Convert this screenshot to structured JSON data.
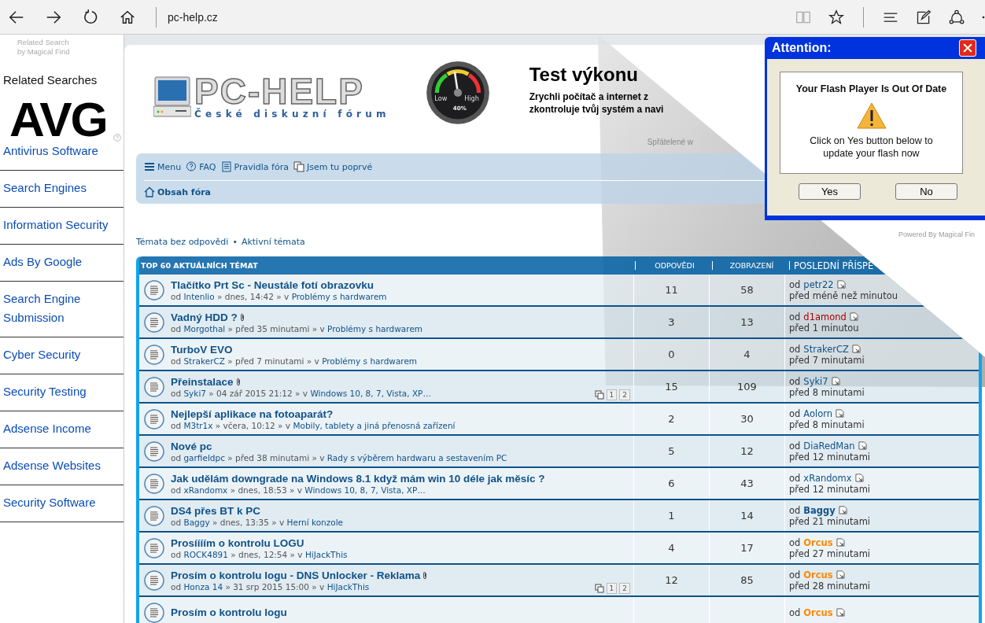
{
  "browser": {
    "url": "pc-help.cz"
  },
  "sidebar": {
    "credit_1": "Related Search",
    "credit_2": "by Magical Find",
    "heading": "Related Searches",
    "logo": "AVG",
    "links": [
      {
        "label": "Antivirus Software"
      },
      {
        "label": "Search Engines"
      },
      {
        "label": "Information Security"
      },
      {
        "label": "Ads By Google"
      },
      {
        "label": "Search Engine Submission"
      },
      {
        "label": "Cyber Security"
      },
      {
        "label": "Security Testing"
      },
      {
        "label": "Adsense Income"
      },
      {
        "label": "Adsense Websites"
      },
      {
        "label": "Security Software"
      }
    ]
  },
  "header": {
    "logo": "PC-HELP",
    "tagline": "České diskuzní fórum",
    "gauge": {
      "low": "Low",
      "high": "High",
      "reading": "40%"
    },
    "ad_title": "Test výkonu",
    "ad_line_1": "Zrychli počítač a internet z",
    "ad_line_2": "zkontroluje tvůj systém a navi",
    "friends": "Spřátelené w"
  },
  "nav": {
    "items": [
      {
        "label": "Menu",
        "kind": "menu"
      },
      {
        "label": "FAQ",
        "kind": "faq"
      },
      {
        "label": "Pravidla fóra",
        "kind": "rules"
      },
      {
        "label": "Jsem tu poprvé",
        "kind": "new"
      }
    ],
    "breadcrumb": "Obsah fóra"
  },
  "quick_links": {
    "first": "Témata bez odpovědi",
    "separator": "•",
    "second": "Aktivní témata"
  },
  "table": {
    "columns": [
      "TOP 60 AKTUÁLNÍCH TÉMAT",
      "ODPOVĚDI",
      "ZOBRAZENÍ",
      "POSLEDNÍ PŘÍSPĚ"
    ],
    "rows": [
      {
        "title": "Tlačítko Prt Sc - Neustále fotí obrazovku",
        "attachment": false,
        "meta": {
          "by": "od",
          "author": "Intenlio",
          "middle": "» dnes, 14:42 » v",
          "forum": "Problémy s hardwarem"
        },
        "replies": "11",
        "views": "58",
        "last_post": {
          "by": "od",
          "author": "petr22",
          "color": "#105289",
          "time": "před méně než minutou"
        }
      },
      {
        "title": "Vadný HDD ?",
        "attachment": true,
        "meta": {
          "by": "od",
          "author": "Morgothal",
          "middle": "» před 35 minutami » v",
          "forum": "Problémy s hardwarem"
        },
        "replies": "3",
        "views": "13",
        "last_post": {
          "by": "od",
          "author": "d1amond",
          "color": "#aa0000",
          "time": "před 1 minutou"
        }
      },
      {
        "title": "TurboV EVO",
        "attachment": false,
        "meta": {
          "by": "od",
          "author": "StrakerCZ",
          "middle": "» před 7 minutami » v",
          "forum": "Problémy s hardwarem"
        },
        "replies": "0",
        "views": "4",
        "last_post": {
          "by": "od",
          "author": "StrakerCZ",
          "color": "#105289",
          "time": "před 7 minutami"
        }
      },
      {
        "title": "Přeinstalace",
        "attachment": true,
        "pages": [
          "1",
          "2"
        ],
        "meta": {
          "by": "od",
          "author": "Syki7",
          "middle": "» 04 zář 2015 21:12 » v",
          "forum": "Windows 10, 8, 7, Vista, XP…"
        },
        "replies": "15",
        "views": "109",
        "last_post": {
          "by": "od",
          "author": "Syki7",
          "color": "#105289",
          "time": "před 8 minutami"
        }
      },
      {
        "title": "Nejlepší aplikace na fotoaparát?",
        "attachment": false,
        "meta": {
          "by": "od",
          "author": "M3tr1x",
          "middle": "» včera, 10:12 » v",
          "forum": "Mobily, tablety a jiná přenosná zařízení"
        },
        "replies": "2",
        "views": "30",
        "last_post": {
          "by": "od",
          "author": "Aolorn",
          "color": "#105289",
          "time": "před 8 minutami"
        }
      },
      {
        "title": "Nové pc",
        "attachment": false,
        "meta": {
          "by": "od",
          "author": "garfieldpc",
          "middle": "» před 38 minutami » v",
          "forum": "Rady s výběrem hardwaru a sestavením PC"
        },
        "replies": "5",
        "views": "12",
        "last_post": {
          "by": "od",
          "author": "DiaRedMan",
          "color": "#105289",
          "time": "před 12 minutami"
        }
      },
      {
        "title": "Jak udělám downgrade na Windows 8.1 když mám win 10 déle jak měsíc ?",
        "attachment": false,
        "meta": {
          "by": "od",
          "author": "xRandomx",
          "middle": "» dnes, 18:53 » v",
          "forum": "Windows 10, 8, 7, Vista, XP…"
        },
        "replies": "6",
        "views": "43",
        "last_post": {
          "by": "od",
          "author": "xRandomx",
          "color": "#105289",
          "time": "před 12 minutami"
        }
      },
      {
        "title": "DS4 přes BT k PC",
        "attachment": false,
        "meta": {
          "by": "od",
          "author": "Baggy",
          "middle": "» dnes, 13:35 » v",
          "forum": "Herní konzole"
        },
        "replies": "1",
        "views": "14",
        "last_post": {
          "by": "od",
          "author": "Baggy",
          "color": "#105289",
          "time": "před 21 minutami"
        }
      },
      {
        "title": "Prosíííím o kontrolu LOGU",
        "attachment": false,
        "meta": {
          "by": "od",
          "author": "ROCK4891",
          "middle": "» dnes, 12:54 » v",
          "forum": "HiJackThis"
        },
        "replies": "4",
        "views": "17",
        "last_post": {
          "by": "od",
          "author": "Orcus",
          "color": "#ff8800",
          "time": "před 27 minutami"
        }
      },
      {
        "title": "Prosím o kontrolu logu - DNS Unlocker - Reklama",
        "attachment": true,
        "pages": [
          "1",
          "2"
        ],
        "meta": {
          "by": "od",
          "author": "Honza 14",
          "middle": "» 31 srp 2015 15:00 » v",
          "forum": "HiJackThis"
        },
        "replies": "12",
        "views": "85",
        "last_post": {
          "by": "od",
          "author": "Orcus",
          "color": "#ff8800",
          "time": "před 28 minutami"
        }
      },
      {
        "title": "Prosím o kontrolu logu",
        "attachment": false,
        "last_post": {
          "by": "od",
          "author": "Orcus",
          "color": "#ff8800"
        }
      }
    ]
  },
  "popup": {
    "title": "Attention:",
    "heading": "Your Flash Player Is Out Of Date",
    "message": "Click on Yes button below to update your flash now",
    "buttons": [
      "Yes",
      "No"
    ],
    "footer": "Powered By Magical Fin"
  }
}
